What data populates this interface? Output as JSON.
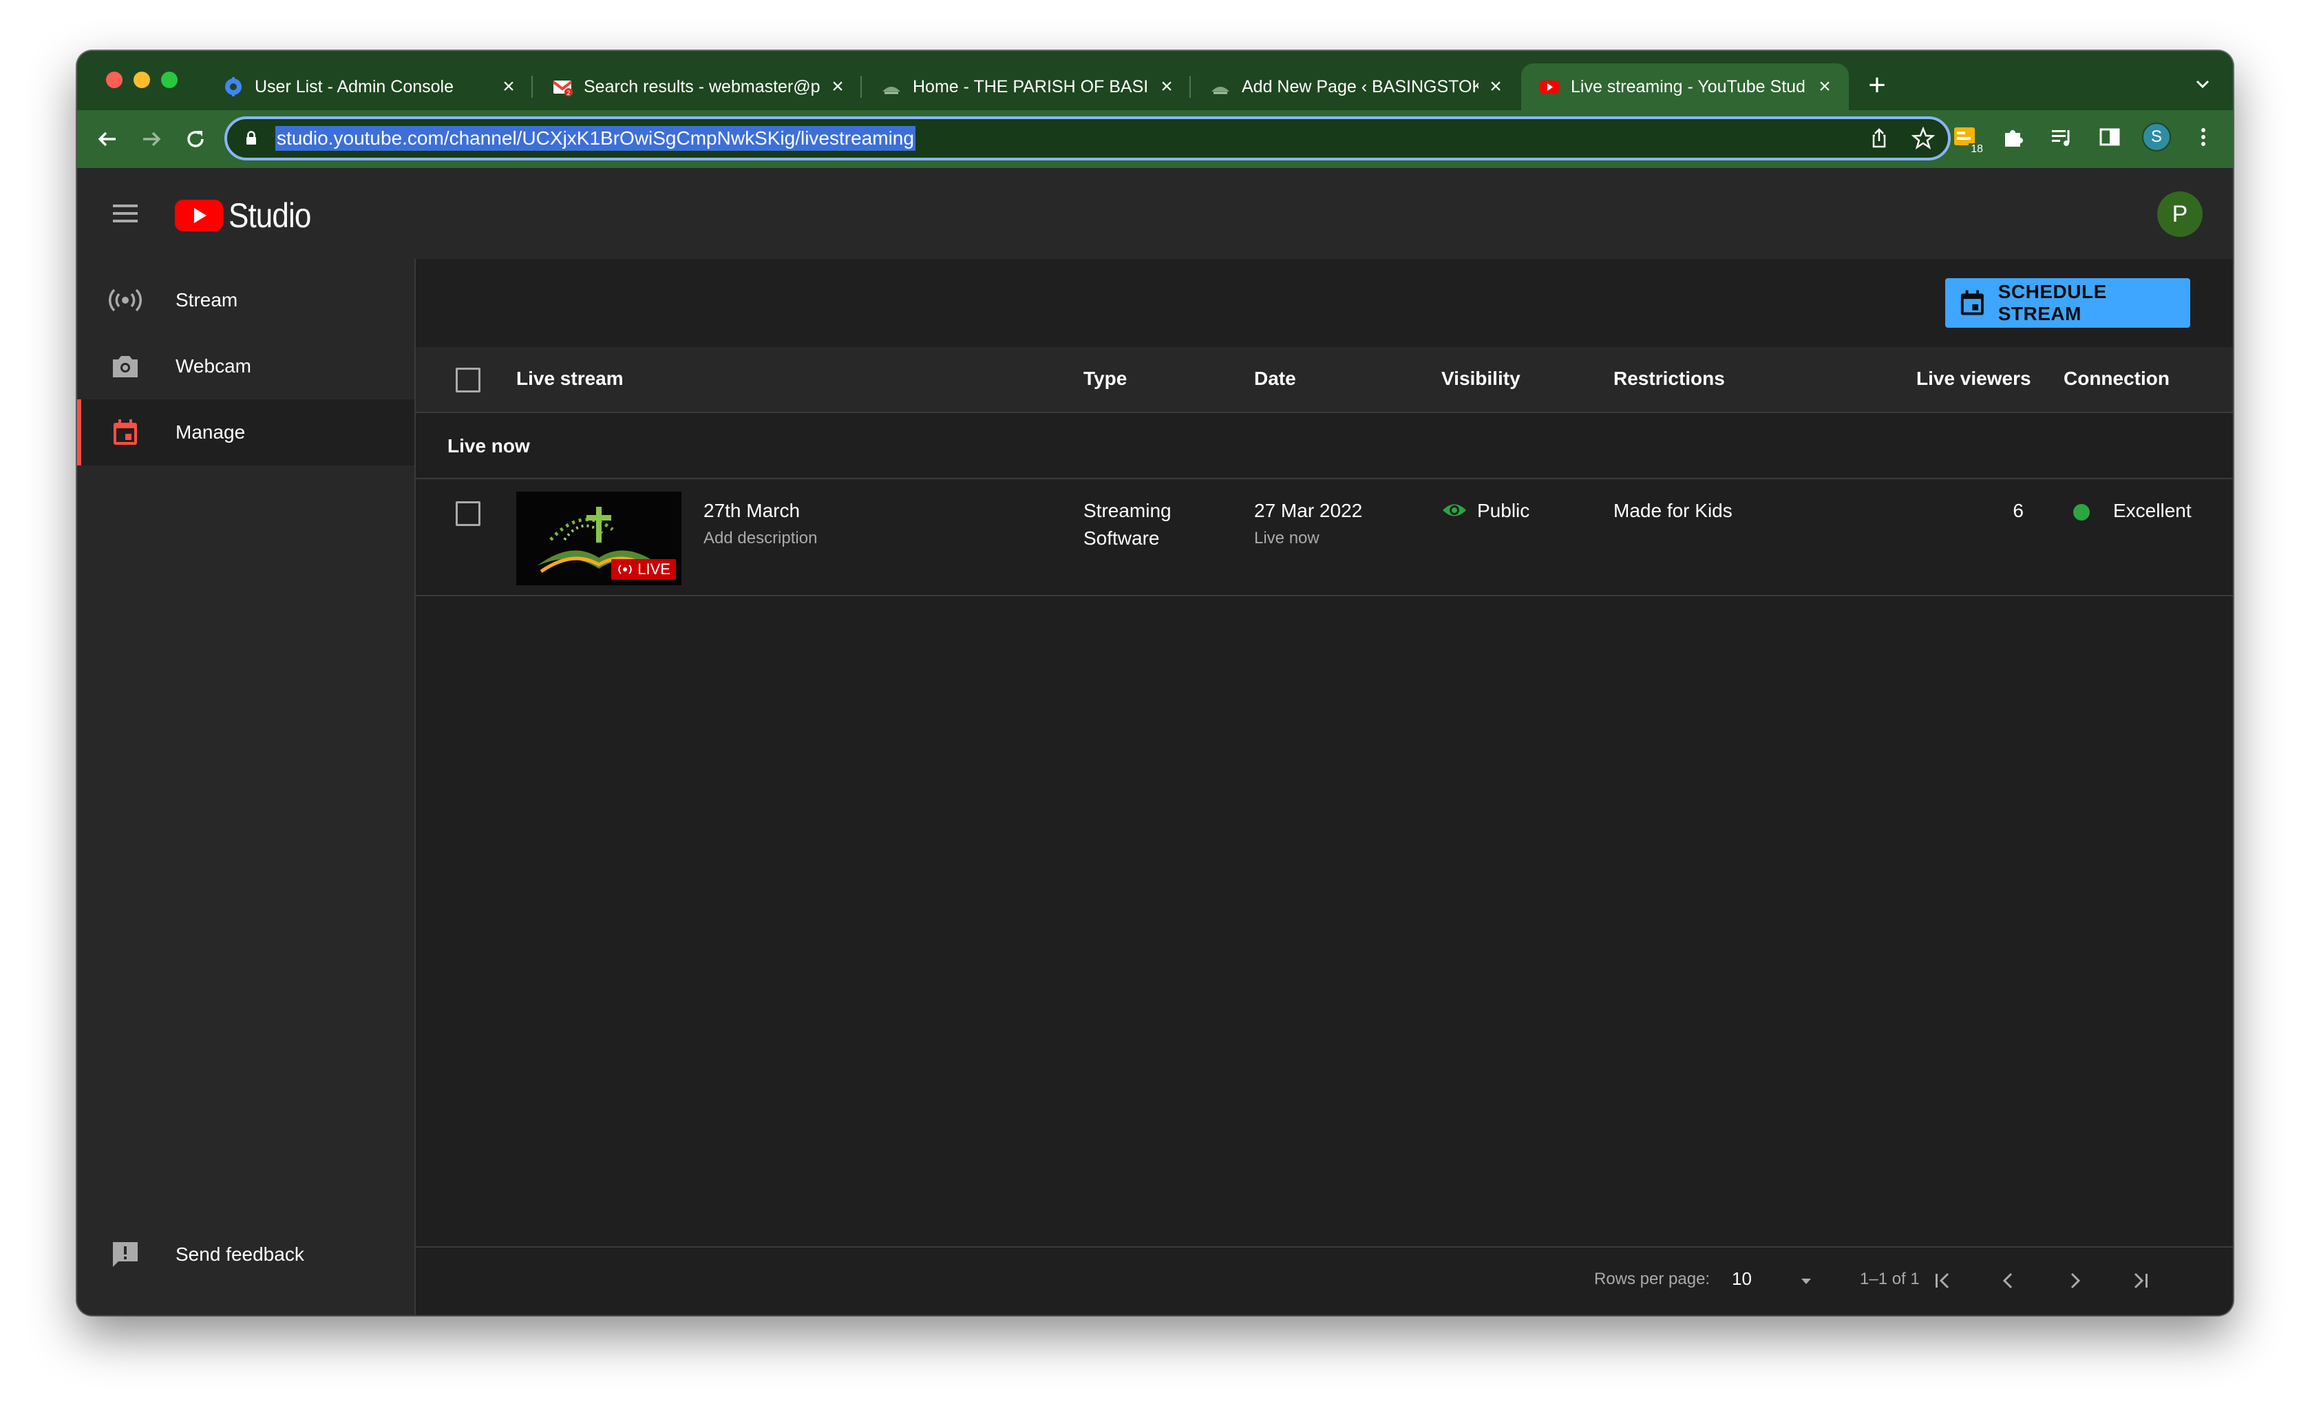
{
  "browser": {
    "tabs": [
      {
        "title": "User List - Admin Console",
        "icon": "admin-console-icon",
        "active": false
      },
      {
        "title": "Search results - webmaster@p",
        "icon": "gmail-icon",
        "active": false
      },
      {
        "title": "Home - THE PARISH OF BASIN",
        "icon": "parish-site-icon",
        "active": false
      },
      {
        "title": "Add New Page ‹ BASINGSTOK",
        "icon": "parish-site-icon",
        "active": false
      },
      {
        "title": "Live streaming - YouTube Stud",
        "icon": "youtube-icon",
        "active": true
      }
    ],
    "url": "studio.youtube.com/channel/UCXjxK1BrOwiSgCmpNwkSKig/livestreaming",
    "extension_badge": "18",
    "profile_initial": "S"
  },
  "header": {
    "logo_text": "Studio",
    "avatar_initial": "P"
  },
  "sidebar": {
    "items": [
      {
        "label": "Stream",
        "icon": "broadcast-icon"
      },
      {
        "label": "Webcam",
        "icon": "camera-icon"
      },
      {
        "label": "Manage",
        "icon": "calendar-icon",
        "active": true
      }
    ],
    "feedback_label": "Send feedback"
  },
  "main": {
    "schedule_button": "SCHEDULE STREAM",
    "columns": {
      "live_stream": "Live stream",
      "type": "Type",
      "date": "Date",
      "visibility": "Visibility",
      "restrictions": "Restrictions",
      "live_viewers": "Live viewers",
      "connection": "Connection"
    },
    "section_label": "Live now",
    "rows": [
      {
        "title": "27th March",
        "description": "Add description",
        "thumb_badge": "LIVE",
        "type_line1": "Streaming",
        "type_line2": "Software",
        "date": "27 Mar 2022",
        "date_status": "Live now",
        "visibility": "Public",
        "restrictions": "Made for Kids",
        "live_viewers": "6",
        "connection": "Excellent"
      }
    ]
  },
  "footer": {
    "rows_per_page_label": "Rows per page:",
    "rows_per_page": "10",
    "range": "1–1 of 1"
  },
  "colors": {
    "accent_blue": "#3ea6ff",
    "active_red": "#ff4e45",
    "status_green": "#2ba640",
    "browser_frame": "#1e4620"
  }
}
